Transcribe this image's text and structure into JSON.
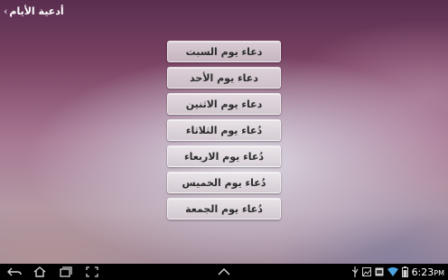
{
  "app": {
    "title": "أدعية الأيام",
    "back_icon": "chevron-left-icon"
  },
  "menu": {
    "items": [
      {
        "label": "دعاء يوم السبت"
      },
      {
        "label": "دعاء يوم الأحد"
      },
      {
        "label": "دعاء يوم الاثنين"
      },
      {
        "label": "دُعاء يوم الثلاثاء"
      },
      {
        "label": "دُعاء يوم الاربعاء"
      },
      {
        "label": "دُعاء يوم الخميس"
      },
      {
        "label": "دُعاء يوم الجمعة"
      }
    ]
  },
  "system_bar": {
    "back_icon": "back-arrow-icon",
    "home_icon": "home-icon",
    "recents_icon": "recent-apps-icon",
    "screenshot_icon": "screenshot-icon",
    "up_icon": "chevron-up-icon",
    "time": "6:23",
    "ampm": "PM",
    "status_icons": [
      "usb-icon",
      "gallery-icon",
      "notification-icon",
      "wifi-icon",
      "battery-icon"
    ]
  }
}
